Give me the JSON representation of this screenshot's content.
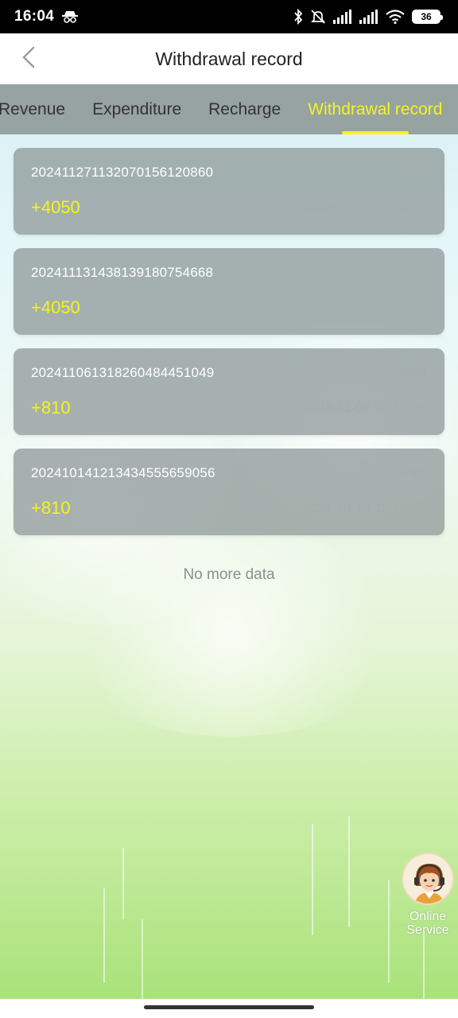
{
  "status_bar": {
    "time": "16:04",
    "battery": "36",
    "icons": [
      "incognito-icon",
      "bluetooth-icon",
      "bell-off-icon",
      "signal-icon",
      "signal-icon",
      "wifi-icon",
      "battery-icon"
    ]
  },
  "header": {
    "title": "Withdrawal record",
    "back_icon": "chevron-left-icon"
  },
  "tabs": [
    {
      "label": "Revenue",
      "active": false
    },
    {
      "label": "Expenditure",
      "active": false
    },
    {
      "label": "Recharge",
      "active": false
    },
    {
      "label": "Withdrawal record",
      "active": true
    }
  ],
  "records": [
    {
      "id": "20241127113207015612086​0",
      "status": "Paid",
      "amount": "+4050",
      "time": "2024-11-27 11:32:07"
    },
    {
      "id": "202411131438139180754668",
      "status": "Paid",
      "amount": "+4050",
      "time": "2024-11-13 14:38:13"
    },
    {
      "id": "202411061318260484451049",
      "status": "Paid",
      "amount": "+810",
      "time": "2024-11-06 13:18:26"
    },
    {
      "id": "202410141213434555659056",
      "status": "Paid",
      "amount": "+810",
      "time": "2024-10-14 12:13:43"
    }
  ],
  "footer_text": "No more data",
  "service": {
    "line1": "Online",
    "line2": "Service"
  },
  "colors": {
    "accent": "#f6f41a",
    "tab_bar": "#97a3a1",
    "card": "#919b9b"
  }
}
